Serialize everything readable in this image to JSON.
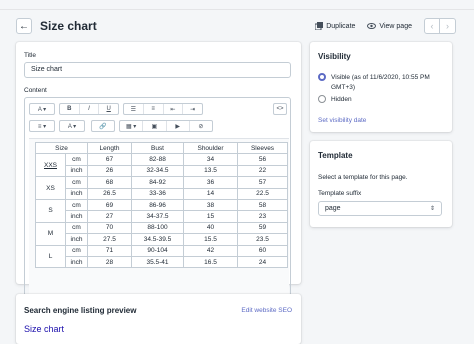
{
  "page": {
    "title": "Size chart",
    "back_icon": "←",
    "duplicate_label": "Duplicate",
    "view_label": "View page",
    "prev_icon": "‹",
    "next_icon": "›"
  },
  "content": {
    "title_label": "Title",
    "title_value": "Size chart",
    "content_label": "Content",
    "toolbar": {
      "paragraph": "A ▾",
      "bold": "B",
      "italic": "I",
      "underline": "U",
      "bullets": "☰",
      "numbers": "≡",
      "outdent": "⇤",
      "indent": "⇥",
      "code": "<>",
      "align": "≡ ▾",
      "color": "A ▾",
      "link": "🔗",
      "table": "▦ ▾",
      "image": "▣",
      "video": "▶",
      "clear": "⊘"
    },
    "table": {
      "headers": [
        "Size",
        "Length",
        "Bust",
        "Shoulder",
        "Sleeves"
      ],
      "rows": [
        {
          "size": "XXS",
          "unit": "cm",
          "length": "67",
          "bust": "82-88",
          "shoulder": "34",
          "sleeves": "56"
        },
        {
          "size": "",
          "unit": "inch",
          "length": "26",
          "bust": "32-34.5",
          "shoulder": "13.5",
          "sleeves": "22"
        },
        {
          "size": "XS",
          "unit": "cm",
          "length": "68",
          "bust": "84-92",
          "shoulder": "36",
          "sleeves": "57"
        },
        {
          "size": "",
          "unit": "inch",
          "length": "26.5",
          "bust": "33-36",
          "shoulder": "14",
          "sleeves": "22.5"
        },
        {
          "size": "S",
          "unit": "cm",
          "length": "69",
          "bust": "86-96",
          "shoulder": "38",
          "sleeves": "58"
        },
        {
          "size": "",
          "unit": "inch",
          "length": "27",
          "bust": "34-37.5",
          "shoulder": "15",
          "sleeves": "23"
        },
        {
          "size": "M",
          "unit": "cm",
          "length": "70",
          "bust": "88-100",
          "shoulder": "40",
          "sleeves": "59"
        },
        {
          "size": "",
          "unit": "inch",
          "length": "27.5",
          "bust": "34.5-39.5",
          "shoulder": "15.5",
          "sleeves": "23.5"
        },
        {
          "size": "L",
          "unit": "cm",
          "length": "71",
          "bust": "90-104",
          "shoulder": "42",
          "sleeves": "60"
        },
        {
          "size": "",
          "unit": "inch",
          "length": "28",
          "bust": "35.5-41",
          "shoulder": "16.5",
          "sleeves": "24"
        }
      ]
    }
  },
  "seo": {
    "heading": "Search engine listing preview",
    "edit_link": "Edit website SEO",
    "preview_title": "Size chart"
  },
  "visibility": {
    "heading": "Visibility",
    "visible_label": "Visible (as of 11/6/2020, 10:55 PM GMT+3)",
    "hidden_label": "Hidden",
    "set_date_link": "Set visibility date"
  },
  "template": {
    "heading": "Template",
    "help": "Select a template for this page.",
    "suffix_label": "Template suffix",
    "suffix_value": "page"
  },
  "colors": {
    "accent": "#5c6ac4",
    "seo_title": "#1a0dab"
  }
}
